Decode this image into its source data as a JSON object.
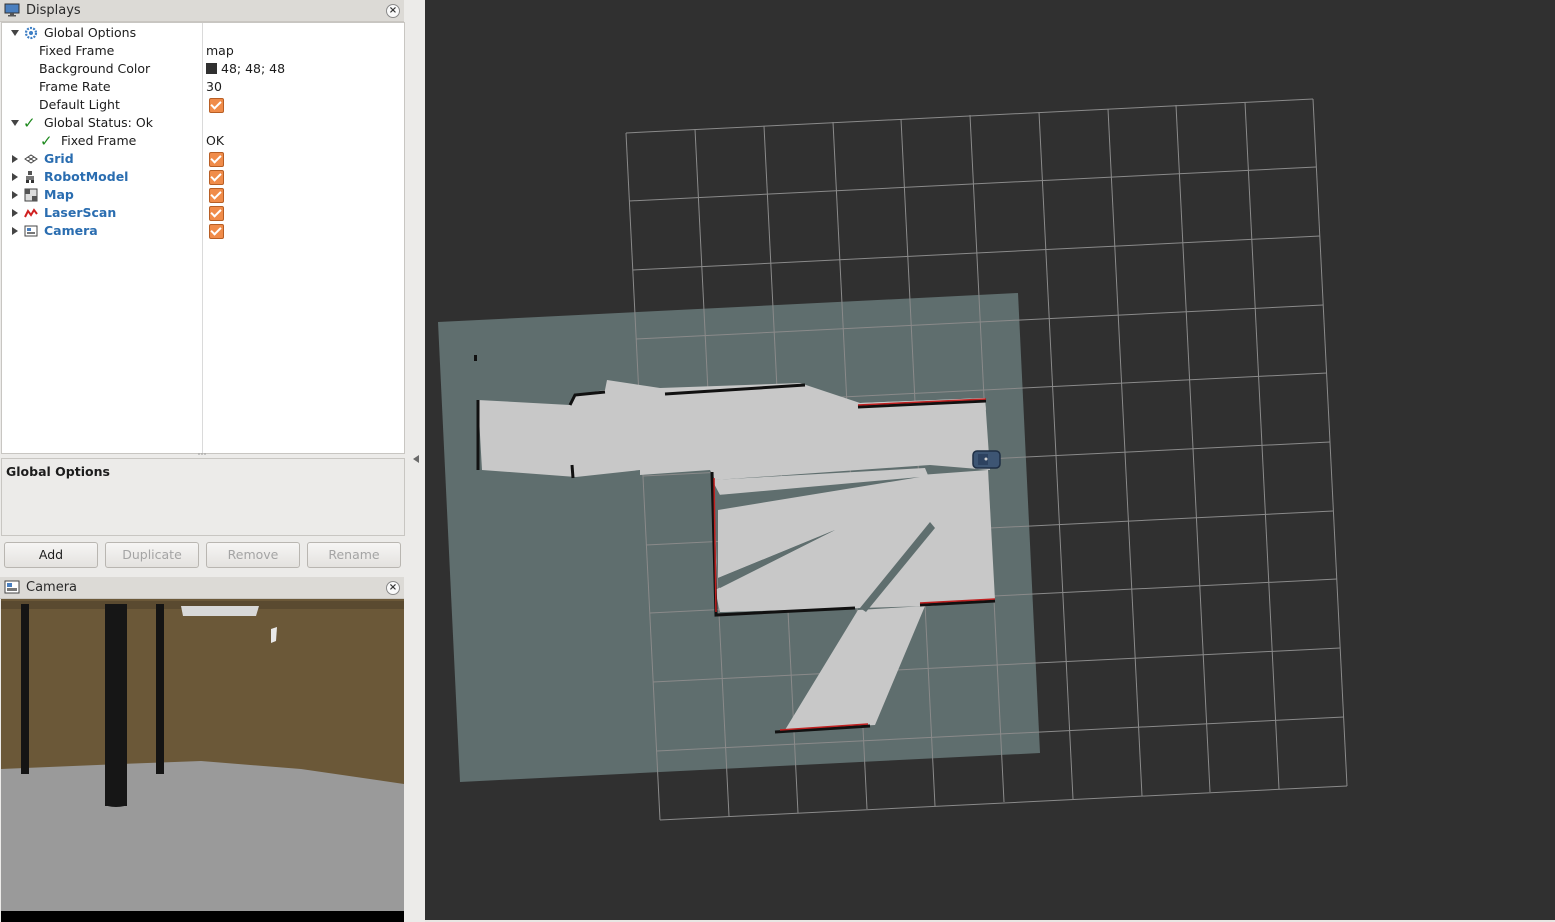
{
  "displays_panel": {
    "title": "Displays",
    "tree": {
      "global_options": {
        "label": "Global Options"
      },
      "fixed_frame": {
        "label": "Fixed Frame",
        "value": "map"
      },
      "background_color": {
        "label": "Background Color",
        "value": "48; 48; 48",
        "color": "#303030"
      },
      "frame_rate": {
        "label": "Frame Rate",
        "value": "30"
      },
      "default_light": {
        "label": "Default Light",
        "checked": true
      },
      "global_status": {
        "label": "Global Status: Ok"
      },
      "status_fixed_frame": {
        "label": "Fixed Frame",
        "value": "OK"
      },
      "displays": [
        {
          "label": "Grid",
          "icon": "grid-icon",
          "checked": true
        },
        {
          "label": "RobotModel",
          "icon": "robot-model-icon",
          "checked": true
        },
        {
          "label": "Map",
          "icon": "map-icon",
          "checked": true
        },
        {
          "label": "LaserScan",
          "icon": "laser-scan-icon",
          "checked": true
        },
        {
          "label": "Camera",
          "icon": "camera-icon",
          "checked": true
        }
      ]
    },
    "description_title": "Global Options",
    "buttons": {
      "add": "Add",
      "duplicate": "Duplicate",
      "remove": "Remove",
      "rename": "Rename"
    }
  },
  "camera_panel": {
    "title": "Camera"
  },
  "colors": {
    "accent_checkbox": "#f08c4a",
    "link_blue": "#2a6db0",
    "status_ok": "#1f8a1f",
    "viewport_bg": "#303030",
    "map_unknown": "#5f6e6e",
    "map_free": "#c8c8c8"
  }
}
